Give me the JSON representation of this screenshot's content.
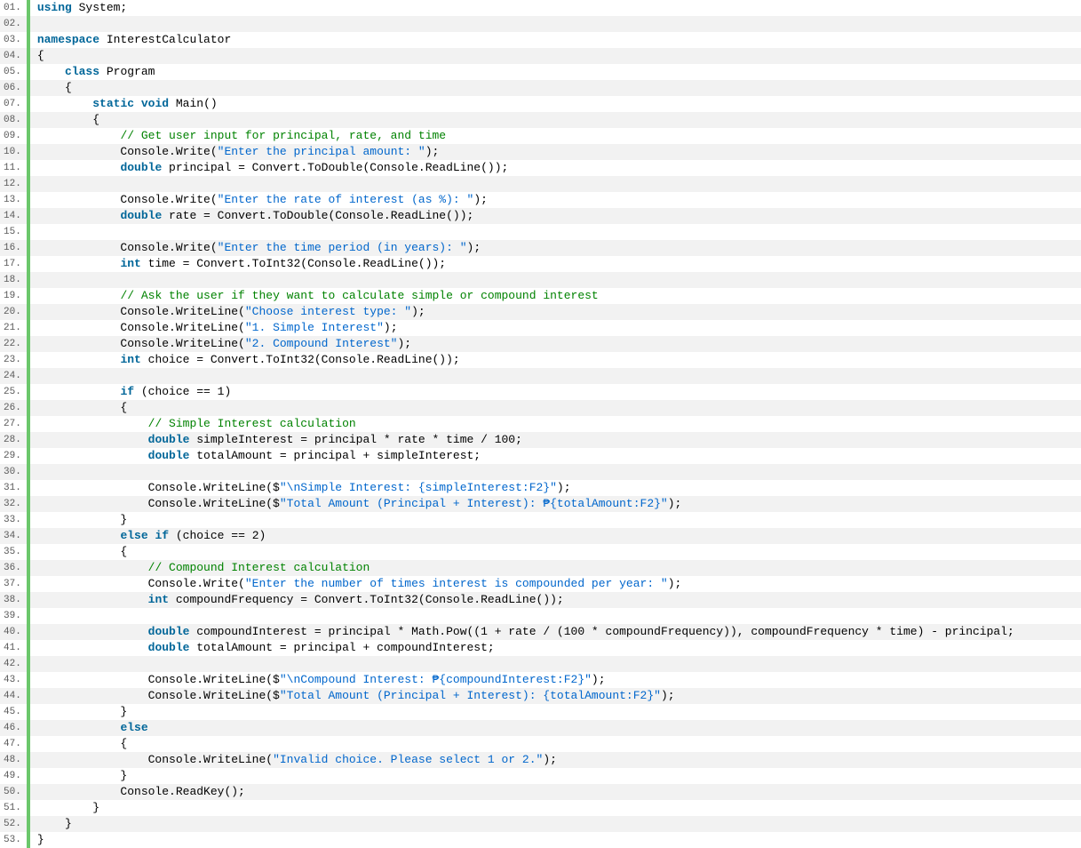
{
  "lines": [
    {
      "n": "01.",
      "tokens": [
        [
          "kw",
          "using"
        ],
        [
          "pln",
          " System;"
        ]
      ]
    },
    {
      "n": "02.",
      "tokens": []
    },
    {
      "n": "03.",
      "tokens": [
        [
          "kw",
          "namespace"
        ],
        [
          "pln",
          " InterestCalculator"
        ]
      ]
    },
    {
      "n": "04.",
      "tokens": [
        [
          "pln",
          "{"
        ]
      ]
    },
    {
      "n": "05.",
      "tokens": [
        [
          "pln",
          "    "
        ],
        [
          "kw",
          "class"
        ],
        [
          "pln",
          " Program"
        ]
      ]
    },
    {
      "n": "06.",
      "tokens": [
        [
          "pln",
          "    {"
        ]
      ]
    },
    {
      "n": "07.",
      "tokens": [
        [
          "pln",
          "        "
        ],
        [
          "kw",
          "static"
        ],
        [
          "pln",
          " "
        ],
        [
          "kw",
          "void"
        ],
        [
          "pln",
          " Main()"
        ]
      ]
    },
    {
      "n": "08.",
      "tokens": [
        [
          "pln",
          "        {"
        ]
      ]
    },
    {
      "n": "09.",
      "tokens": [
        [
          "pln",
          "            "
        ],
        [
          "com",
          "// Get user input for principal, rate, and time"
        ]
      ]
    },
    {
      "n": "10.",
      "tokens": [
        [
          "pln",
          "            Console.Write("
        ],
        [
          "str",
          "\"Enter the principal amount: \""
        ],
        [
          "pln",
          ");"
        ]
      ]
    },
    {
      "n": "11.",
      "tokens": [
        [
          "pln",
          "            "
        ],
        [
          "kw",
          "double"
        ],
        [
          "pln",
          " principal = Convert.ToDouble(Console.ReadLine());"
        ]
      ]
    },
    {
      "n": "12.",
      "tokens": []
    },
    {
      "n": "13.",
      "tokens": [
        [
          "pln",
          "            Console.Write("
        ],
        [
          "str",
          "\"Enter the rate of interest (as %): \""
        ],
        [
          "pln",
          ");"
        ]
      ]
    },
    {
      "n": "14.",
      "tokens": [
        [
          "pln",
          "            "
        ],
        [
          "kw",
          "double"
        ],
        [
          "pln",
          " rate = Convert.ToDouble(Console.ReadLine());"
        ]
      ]
    },
    {
      "n": "15.",
      "tokens": []
    },
    {
      "n": "16.",
      "tokens": [
        [
          "pln",
          "            Console.Write("
        ],
        [
          "str",
          "\"Enter the time period (in years): \""
        ],
        [
          "pln",
          ");"
        ]
      ]
    },
    {
      "n": "17.",
      "tokens": [
        [
          "pln",
          "            "
        ],
        [
          "kw",
          "int"
        ],
        [
          "pln",
          " time = Convert.ToInt32(Console.ReadLine());"
        ]
      ]
    },
    {
      "n": "18.",
      "tokens": []
    },
    {
      "n": "19.",
      "tokens": [
        [
          "pln",
          "            "
        ],
        [
          "com",
          "// Ask the user if they want to calculate simple or compound interest"
        ]
      ]
    },
    {
      "n": "20.",
      "tokens": [
        [
          "pln",
          "            Console.WriteLine("
        ],
        [
          "str",
          "\"Choose interest type: \""
        ],
        [
          "pln",
          ");"
        ]
      ]
    },
    {
      "n": "21.",
      "tokens": [
        [
          "pln",
          "            Console.WriteLine("
        ],
        [
          "str",
          "\"1. Simple Interest\""
        ],
        [
          "pln",
          ");"
        ]
      ]
    },
    {
      "n": "22.",
      "tokens": [
        [
          "pln",
          "            Console.WriteLine("
        ],
        [
          "str",
          "\"2. Compound Interest\""
        ],
        [
          "pln",
          ");"
        ]
      ]
    },
    {
      "n": "23.",
      "tokens": [
        [
          "pln",
          "            "
        ],
        [
          "kw",
          "int"
        ],
        [
          "pln",
          " choice = Convert.ToInt32(Console.ReadLine());"
        ]
      ]
    },
    {
      "n": "24.",
      "tokens": []
    },
    {
      "n": "25.",
      "tokens": [
        [
          "pln",
          "            "
        ],
        [
          "kw",
          "if"
        ],
        [
          "pln",
          " (choice == 1)"
        ]
      ]
    },
    {
      "n": "26.",
      "tokens": [
        [
          "pln",
          "            {"
        ]
      ]
    },
    {
      "n": "27.",
      "tokens": [
        [
          "pln",
          "                "
        ],
        [
          "com",
          "// Simple Interest calculation"
        ]
      ]
    },
    {
      "n": "28.",
      "tokens": [
        [
          "pln",
          "                "
        ],
        [
          "kw",
          "double"
        ],
        [
          "pln",
          " simpleInterest = principal * rate * time / 100;"
        ]
      ]
    },
    {
      "n": "29.",
      "tokens": [
        [
          "pln",
          "                "
        ],
        [
          "kw",
          "double"
        ],
        [
          "pln",
          " totalAmount = principal + simpleInterest;"
        ]
      ]
    },
    {
      "n": "30.",
      "tokens": []
    },
    {
      "n": "31.",
      "tokens": [
        [
          "pln",
          "                Console.WriteLine($"
        ],
        [
          "str",
          "\"\\nSimple Interest: {simpleInterest:F2}\""
        ],
        [
          "pln",
          ");"
        ]
      ]
    },
    {
      "n": "32.",
      "tokens": [
        [
          "pln",
          "                Console.WriteLine($"
        ],
        [
          "str",
          "\"Total Amount (Principal + Interest): ₱{totalAmount:F2}\""
        ],
        [
          "pln",
          ");"
        ]
      ]
    },
    {
      "n": "33.",
      "tokens": [
        [
          "pln",
          "            }"
        ]
      ]
    },
    {
      "n": "34.",
      "tokens": [
        [
          "pln",
          "            "
        ],
        [
          "kw",
          "else"
        ],
        [
          "pln",
          " "
        ],
        [
          "kw",
          "if"
        ],
        [
          "pln",
          " (choice == 2)"
        ]
      ]
    },
    {
      "n": "35.",
      "tokens": [
        [
          "pln",
          "            {"
        ]
      ]
    },
    {
      "n": "36.",
      "tokens": [
        [
          "pln",
          "                "
        ],
        [
          "com",
          "// Compound Interest calculation"
        ]
      ]
    },
    {
      "n": "37.",
      "tokens": [
        [
          "pln",
          "                Console.Write("
        ],
        [
          "str",
          "\"Enter the number of times interest is compounded per year: \""
        ],
        [
          "pln",
          ");"
        ]
      ]
    },
    {
      "n": "38.",
      "tokens": [
        [
          "pln",
          "                "
        ],
        [
          "kw",
          "int"
        ],
        [
          "pln",
          " compoundFrequency = Convert.ToInt32(Console.ReadLine());"
        ]
      ]
    },
    {
      "n": "39.",
      "tokens": []
    },
    {
      "n": "40.",
      "tokens": [
        [
          "pln",
          "                "
        ],
        [
          "kw",
          "double"
        ],
        [
          "pln",
          " compoundInterest = principal * Math.Pow((1 + rate / (100 * compoundFrequency)), compoundFrequency * time) - principal;"
        ]
      ]
    },
    {
      "n": "41.",
      "tokens": [
        [
          "pln",
          "                "
        ],
        [
          "kw",
          "double"
        ],
        [
          "pln",
          " totalAmount = principal + compoundInterest;"
        ]
      ]
    },
    {
      "n": "42.",
      "tokens": []
    },
    {
      "n": "43.",
      "tokens": [
        [
          "pln",
          "                Console.WriteLine($"
        ],
        [
          "str",
          "\"\\nCompound Interest: ₱{compoundInterest:F2}\""
        ],
        [
          "pln",
          ");"
        ]
      ]
    },
    {
      "n": "44.",
      "tokens": [
        [
          "pln",
          "                Console.WriteLine($"
        ],
        [
          "str",
          "\"Total Amount (Principal + Interest): {totalAmount:F2}\""
        ],
        [
          "pln",
          ");"
        ]
      ]
    },
    {
      "n": "45.",
      "tokens": [
        [
          "pln",
          "            }"
        ]
      ]
    },
    {
      "n": "46.",
      "tokens": [
        [
          "pln",
          "            "
        ],
        [
          "kw",
          "else"
        ]
      ]
    },
    {
      "n": "47.",
      "tokens": [
        [
          "pln",
          "            {"
        ]
      ]
    },
    {
      "n": "48.",
      "tokens": [
        [
          "pln",
          "                Console.WriteLine("
        ],
        [
          "str",
          "\"Invalid choice. Please select 1 or 2.\""
        ],
        [
          "pln",
          ");"
        ]
      ]
    },
    {
      "n": "49.",
      "tokens": [
        [
          "pln",
          "            }"
        ]
      ]
    },
    {
      "n": "50.",
      "tokens": [
        [
          "pln",
          "            Console.ReadKey();"
        ]
      ]
    },
    {
      "n": "51.",
      "tokens": [
        [
          "pln",
          "        }"
        ]
      ]
    },
    {
      "n": "52.",
      "tokens": [
        [
          "pln",
          "    }"
        ]
      ]
    },
    {
      "n": "53.",
      "tokens": [
        [
          "pln",
          "}"
        ]
      ]
    }
  ]
}
